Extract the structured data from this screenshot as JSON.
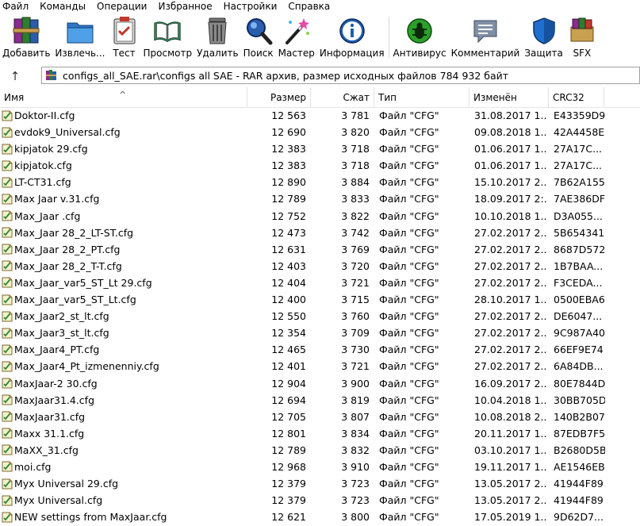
{
  "menu": [
    "Файл",
    "Команды",
    "Операции",
    "Избранное",
    "Настройки",
    "Справка"
  ],
  "toolbar": [
    {
      "label": "Добавить",
      "icon": "books-icon"
    },
    {
      "label": "Извлечь...",
      "icon": "folder-icon"
    },
    {
      "label": "Тест",
      "icon": "clipboard-check-icon"
    },
    {
      "label": "Просмотр",
      "icon": "book-icon"
    },
    {
      "label": "Удалить",
      "icon": "trash-icon"
    },
    {
      "label": "Поиск",
      "icon": "magnifier-icon"
    },
    {
      "label": "Мастер",
      "icon": "wand-icon"
    },
    {
      "label": "Информация",
      "icon": "info-icon"
    },
    {
      "label": "Антивирус",
      "icon": "bug-icon"
    },
    {
      "label": "Комментарий",
      "icon": "comment-icon"
    },
    {
      "label": "Защита",
      "icon": "shield-icon"
    },
    {
      "label": "SFX",
      "icon": "sfx-icon"
    }
  ],
  "address": {
    "up_arrow": "↑",
    "path": "configs_all_SAE.rar\\configs all SAE - RAR архив, размер исходных файлов 784 932 байт"
  },
  "columns": {
    "name": "Имя",
    "size": "Размер",
    "packed": "Сжат",
    "type": "Тип",
    "modified": "Изменён",
    "crc": "CRC32",
    "sort_arrow": "^"
  },
  "files": [
    {
      "name": "Doktor-II.cfg",
      "size": "12 563",
      "packed": "3 781",
      "type": "Файл \"CFG\"",
      "modified": "31.08.2017 1...",
      "crc": "E43359D9"
    },
    {
      "name": "evdok9_Universal.cfg",
      "size": "12 690",
      "packed": "3 820",
      "type": "Файл \"CFG\"",
      "modified": "09.08.2018 1...",
      "crc": "42A4458E"
    },
    {
      "name": "kipjatok 29.cfg",
      "size": "12 383",
      "packed": "3 718",
      "type": "Файл \"CFG\"",
      "modified": "01.06.2017 1...",
      "crc": "27A17C..."
    },
    {
      "name": "kipjatok.cfg",
      "size": "12 383",
      "packed": "3 718",
      "type": "Файл \"CFG\"",
      "modified": "01.06.2017 1...",
      "crc": "27A17C..."
    },
    {
      "name": "LT-CT31.cfg",
      "size": "12 890",
      "packed": "3 884",
      "type": "Файл \"CFG\"",
      "modified": "15.10.2017 2...",
      "crc": "7B62A155"
    },
    {
      "name": "Max Jaar v.31.cfg",
      "size": "12 789",
      "packed": "3 833",
      "type": "Файл \"CFG\"",
      "modified": "18.09.2017 2:...",
      "crc": "7AE386DF"
    },
    {
      "name": "Max_Jaar .cfg",
      "size": "12 752",
      "packed": "3 822",
      "type": "Файл \"CFG\"",
      "modified": "10.10.2018 1...",
      "crc": "D3A055..."
    },
    {
      "name": "Max_Jaar 28_2_LT-ST.cfg",
      "size": "12 473",
      "packed": "3 742",
      "type": "Файл \"CFG\"",
      "modified": "27.02.2017 2...",
      "crc": "5B654341"
    },
    {
      "name": "Max_Jaar 28_2_PT.cfg",
      "size": "12 631",
      "packed": "3 769",
      "type": "Файл \"CFG\"",
      "modified": "27.02.2017 2...",
      "crc": "8687D572"
    },
    {
      "name": "Max_Jaar 28_2_T-T.cfg",
      "size": "12 403",
      "packed": "3 720",
      "type": "Файл \"CFG\"",
      "modified": "27.02.2017 2...",
      "crc": "1B7BAA..."
    },
    {
      "name": "Max_Jaar_var5_ST_Lt 29.cfg",
      "size": "12 404",
      "packed": "3 721",
      "type": "Файл \"CFG\"",
      "modified": "27.02.2017 2...",
      "crc": "F3CEDA..."
    },
    {
      "name": "Max_Jaar_var5_ST_Lt.cfg",
      "size": "12 400",
      "packed": "3 715",
      "type": "Файл \"CFG\"",
      "modified": "28.10.2017 1...",
      "crc": "0500EBA6"
    },
    {
      "name": "Max_Jaar2_st_lt.cfg",
      "size": "12 550",
      "packed": "3 760",
      "type": "Файл \"CFG\"",
      "modified": "27.02.2017 2...",
      "crc": "DE6047..."
    },
    {
      "name": "Max_Jaar3_st_lt.cfg",
      "size": "12 354",
      "packed": "3 709",
      "type": "Файл \"CFG\"",
      "modified": "27.02.2017 2...",
      "crc": "9C987A40"
    },
    {
      "name": "Max_Jaar4_PT.cfg",
      "size": "12 465",
      "packed": "3 730",
      "type": "Файл \"CFG\"",
      "modified": "27.02.2017 2...",
      "crc": "66EF9E74"
    },
    {
      "name": "Max_Jaar4_Pt_izmenenniy.cfg",
      "size": "12 401",
      "packed": "3 721",
      "type": "Файл \"CFG\"",
      "modified": "27.02.2017 2...",
      "crc": "6A84DB..."
    },
    {
      "name": "MaxJaar-2 30.cfg",
      "size": "12 904",
      "packed": "3 900",
      "type": "Файл \"CFG\"",
      "modified": "16.09.2017 2...",
      "crc": "80E7844D"
    },
    {
      "name": "MaxJaar31.4.cfg",
      "size": "12 694",
      "packed": "3 819",
      "type": "Файл \"CFG\"",
      "modified": "10.04.2018 1...",
      "crc": "30BB705D"
    },
    {
      "name": "MaxJaar31.cfg",
      "size": "12 705",
      "packed": "3 807",
      "type": "Файл \"CFG\"",
      "modified": "10.08.2018 2...",
      "crc": "140B2B07"
    },
    {
      "name": "Maxx 31.1.cfg",
      "size": "12 801",
      "packed": "3 834",
      "type": "Файл \"CFG\"",
      "modified": "20.11.2017 1...",
      "crc": "87EDB7F5"
    },
    {
      "name": "MaXX_31.cfg",
      "size": "12 789",
      "packed": "3 832",
      "type": "Файл \"CFG\"",
      "modified": "03.10.2017 1...",
      "crc": "B2680D5B"
    },
    {
      "name": "moi.cfg",
      "size": "12 968",
      "packed": "3 910",
      "type": "Файл \"CFG\"",
      "modified": "19.11.2017 1...",
      "crc": "AE1546EB"
    },
    {
      "name": "Myx Universal 29.cfg",
      "size": "12 379",
      "packed": "3 723",
      "type": "Файл \"CFG\"",
      "modified": "13.05.2017 2...",
      "crc": "41944F89"
    },
    {
      "name": "Myx Universal.cfg",
      "size": "12 379",
      "packed": "3 723",
      "type": "Файл \"CFG\"",
      "modified": "13.05.2017 2...",
      "crc": "41944F89"
    },
    {
      "name": "NEW settings from MaxJaar.cfg",
      "size": "12 621",
      "packed": "3 800",
      "type": "Файл \"CFG\"",
      "modified": "17.05.2019 1...",
      "crc": "9D62D7..."
    }
  ]
}
